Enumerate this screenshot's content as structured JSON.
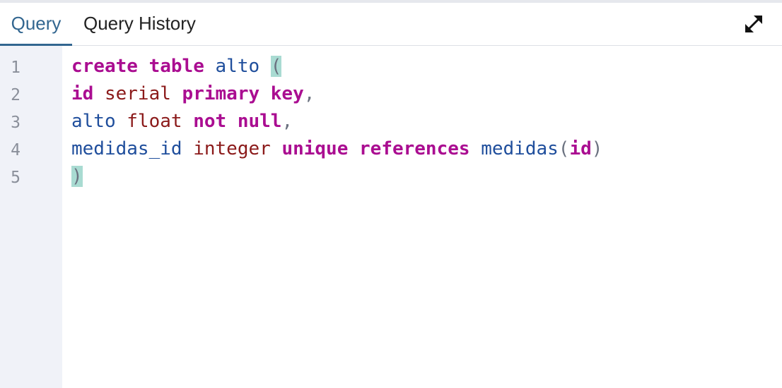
{
  "tabs": {
    "query_label": "Query",
    "history_label": "Query History"
  },
  "icons": {
    "expand": "expand-icon"
  },
  "colors": {
    "active_tab": "#326690",
    "keyword": "#aa0d91",
    "type": "#8b1a1a",
    "identifier": "#1f4e9c",
    "bracket_highlight": "#a9dbd2",
    "gutter_bg": "#f0f2f8"
  },
  "editor": {
    "line_numbers": [
      "1",
      "2",
      "3",
      "4",
      "5"
    ],
    "lines": [
      [
        {
          "text": "create",
          "style": "kw"
        },
        {
          "text": " ",
          "style": "plain"
        },
        {
          "text": "table",
          "style": "kw"
        },
        {
          "text": " ",
          "style": "plain"
        },
        {
          "text": "alto",
          "style": "id"
        },
        {
          "text": " ",
          "style": "plain"
        },
        {
          "text": "(",
          "style": "bracket"
        }
      ],
      [
        {
          "text": "id",
          "style": "kw"
        },
        {
          "text": " ",
          "style": "plain"
        },
        {
          "text": "serial",
          "style": "type"
        },
        {
          "text": " ",
          "style": "plain"
        },
        {
          "text": "primary",
          "style": "kw"
        },
        {
          "text": " ",
          "style": "plain"
        },
        {
          "text": "key",
          "style": "kw"
        },
        {
          "text": ",",
          "style": "punct"
        }
      ],
      [
        {
          "text": "alto",
          "style": "id"
        },
        {
          "text": " ",
          "style": "plain"
        },
        {
          "text": "float",
          "style": "type"
        },
        {
          "text": " ",
          "style": "plain"
        },
        {
          "text": "not",
          "style": "kw"
        },
        {
          "text": " ",
          "style": "plain"
        },
        {
          "text": "null",
          "style": "kw"
        },
        {
          "text": ",",
          "style": "punct"
        }
      ],
      [
        {
          "text": "medidas_id",
          "style": "id"
        },
        {
          "text": " ",
          "style": "plain"
        },
        {
          "text": "integer",
          "style": "type"
        },
        {
          "text": " ",
          "style": "plain"
        },
        {
          "text": "unique",
          "style": "kw"
        },
        {
          "text": " ",
          "style": "plain"
        },
        {
          "text": "references",
          "style": "kw"
        },
        {
          "text": " ",
          "style": "plain"
        },
        {
          "text": "medidas",
          "style": "id"
        },
        {
          "text": "(",
          "style": "punct"
        },
        {
          "text": "id",
          "style": "kw"
        },
        {
          "text": ")",
          "style": "punct"
        }
      ],
      [
        {
          "text": ")",
          "style": "bracket"
        }
      ]
    ]
  }
}
